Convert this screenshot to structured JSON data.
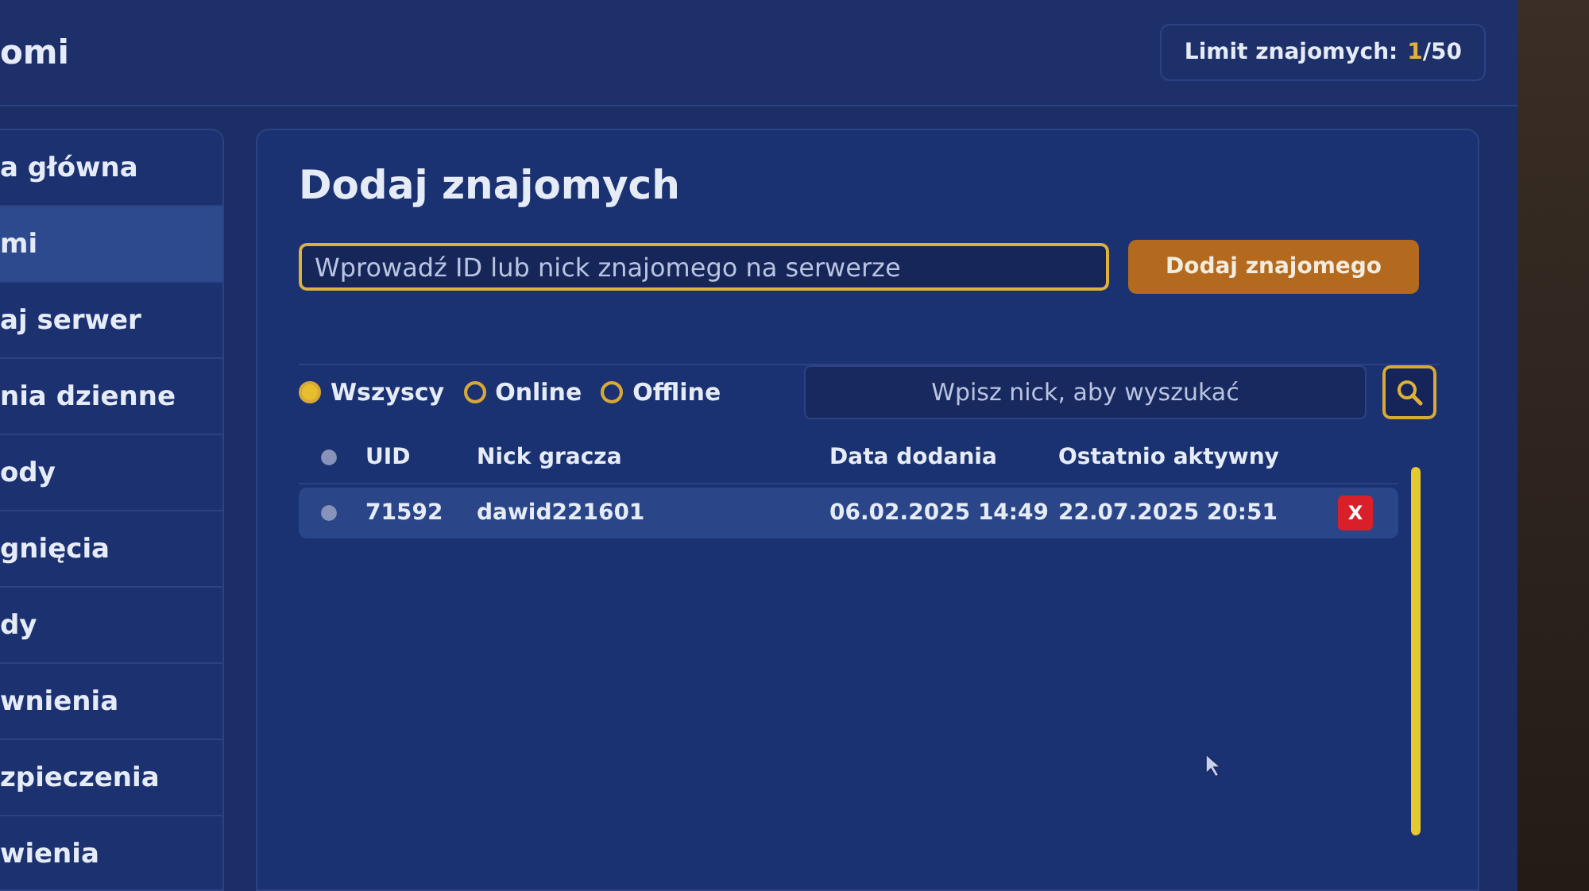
{
  "header": {
    "title": "omi",
    "limit_label": "Limit znajomych:",
    "limit_current": "1",
    "limit_max": "/50"
  },
  "sidebar": {
    "items": [
      {
        "label": "a główna",
        "selected": false
      },
      {
        "label": "mi",
        "selected": true
      },
      {
        "label": "aj serwer",
        "selected": false
      },
      {
        "label": "nia dzienne",
        "selected": false
      },
      {
        "label": "ody",
        "selected": false
      },
      {
        "label": "gnięcia",
        "selected": false
      },
      {
        "label": "dy",
        "selected": false
      },
      {
        "label": "wnienia",
        "selected": false
      },
      {
        "label": "zpieczenia",
        "selected": false
      },
      {
        "label": "wienia",
        "selected": false
      }
    ]
  },
  "add_friend": {
    "title": "Dodaj znajomych",
    "placeholder": "Wprowadź ID lub nick znajomego na serwerze",
    "button": "Dodaj znajomego"
  },
  "filters": [
    {
      "label": "Wszyscy",
      "selected": true
    },
    {
      "label": "Online",
      "selected": false
    },
    {
      "label": "Offline",
      "selected": false
    }
  ],
  "search": {
    "placeholder": "Wpisz nick, aby wyszukać"
  },
  "table": {
    "columns": [
      "UID",
      "Nick gracza",
      "Data dodania",
      "Ostatnio aktywny"
    ],
    "rows": [
      {
        "online": false,
        "cells": [
          "71592",
          "dawid221601",
          "06.02.2025 14:49",
          "22.07.2025 20:51"
        ],
        "delete": "X"
      }
    ]
  }
}
